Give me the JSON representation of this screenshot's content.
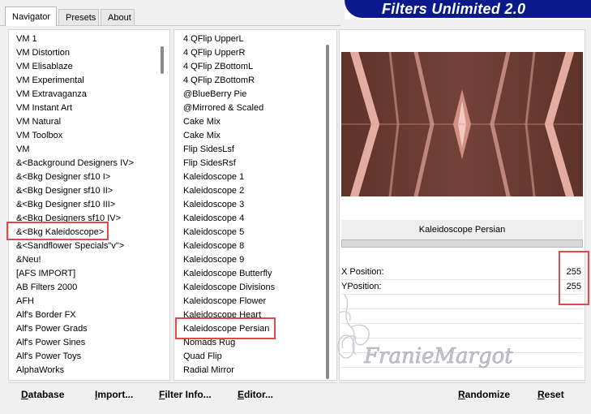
{
  "tabs": [
    "Navigator",
    "Presets",
    "About"
  ],
  "banner": {
    "title": "Filters Unlimited 2.0"
  },
  "categories": [
    "VM 1",
    "VM Distortion",
    "VM Elisablaze",
    "VM Experimental",
    "VM Extravaganza",
    "VM Instant Art",
    "VM Natural",
    "VM Toolbox",
    "VM",
    "&<Background Designers IV>",
    "&<Bkg Designer sf10 I>",
    "&<Bkg Designer sf10 II>",
    "&<Bkg Designer sf10 III>",
    "&<Bkg Designers sf10 IV>",
    "&<Bkg Kaleidoscope>",
    "&<Sandflower Specials\"v\">",
    "&Neu!",
    "[AFS IMPORT]",
    "AB Filters 2000",
    "AFH",
    "Alf's Border FX",
    "Alf's Power Grads",
    "Alf's Power Sines",
    "Alf's Power Toys",
    "AlphaWorks"
  ],
  "filters": [
    "4 QFlip UpperL",
    "4 QFlip UpperR",
    "4 QFlip ZBottomL",
    "4 QFlip ZBottomR",
    "@BlueBerry Pie",
    "@Mirrored & Scaled",
    "Cake Mix",
    "Cake Mix",
    "Flip SidesLsf",
    "Flip SidesRsf",
    "Kaleidoscope 1",
    "Kaleidoscope 2",
    "Kaleidoscope 3",
    "Kaleidoscope 4",
    "Kaleidoscope 5",
    "Kaleidoscope 8",
    "Kaleidoscope 9",
    "Kaleidoscope Butterfly",
    "Kaleidoscope Divisions",
    "Kaleidoscope Flower",
    "Kaleidoscope Heart",
    "Kaleidoscope Persian",
    "Nomads Rug",
    "Quad Flip",
    "Radial Mirror"
  ],
  "selected_category": "&<Bkg Kaleidoscope>",
  "selected_filter": "Kaleidoscope Persian",
  "filter_name": "Kaleidoscope Persian",
  "params": [
    {
      "label": "X Position:",
      "value": "255"
    },
    {
      "label": "YPosition:",
      "value": "255"
    }
  ],
  "buttons": {
    "database": "Database",
    "import": "Import...",
    "filter_info": "Filter Info...",
    "editor": "Editor...",
    "randomize": "Randomize",
    "reset": "Reset"
  },
  "watermark": "FranieMargot",
  "colors": {
    "highlight": "#e04a4a",
    "banner_blue": "#0a1a8a",
    "preview_base": "#6b3a30"
  }
}
